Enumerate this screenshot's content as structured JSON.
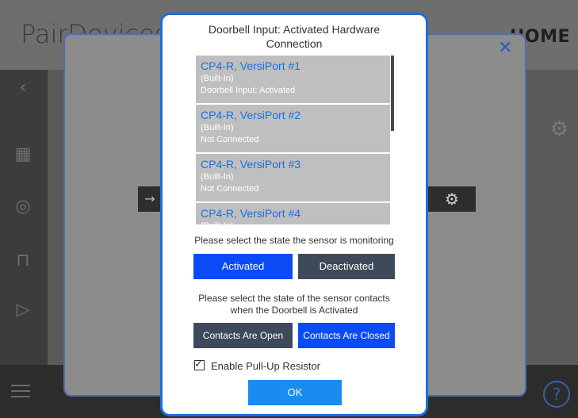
{
  "background": {
    "title": "PairDevices",
    "brand": "HOME",
    "help_icon": "?"
  },
  "dialog": {
    "title": "Doorbell Input: Activated Hardware Connection",
    "ports": [
      {
        "name": "CP4-R, VersiPort #1",
        "type": "(Built-In)",
        "status": "Doorbell Input: Activated"
      },
      {
        "name": "CP4-R, VersiPort #2",
        "type": "(Built-In)",
        "status": "Not Connected"
      },
      {
        "name": "CP4-R, VersiPort #3",
        "type": "(Built-In)",
        "status": "Not Connected"
      },
      {
        "name": "CP4-R, VersiPort #4",
        "type": "(Built-In)",
        "status": ""
      }
    ],
    "sensor_state_prompt": "Please select the state the sensor is monitoring",
    "activated_label": "Activated",
    "deactivated_label": "Deactivated",
    "contacts_prompt_line1": "Please select the state of the sensor contacts",
    "contacts_prompt_line2": "when the Doorbell is Activated",
    "contacts_open_label": "Contacts Are Open",
    "contacts_closed_label": "Contacts Are Closed",
    "pullup_label": "Enable Pull-Up Resistor",
    "pullup_checked": true,
    "ok_label": "OK"
  },
  "colors": {
    "selected_button": "#0a4bf5",
    "unselected_button": "#3e4a5a",
    "ok_button": "#1a8cf0",
    "port_name": "#1a6fe0",
    "dialog_border": "#1a6fe0"
  }
}
